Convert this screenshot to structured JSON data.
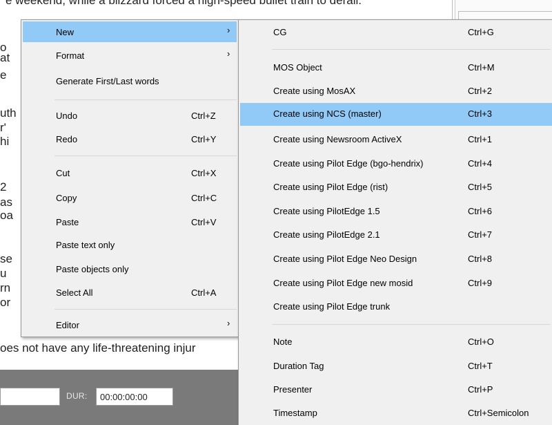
{
  "document": {
    "top_line": "e weekend, while a blizzard forced a high-speed bullet train to derail.",
    "bottom_line": "oes not have any life-threatening injur",
    "fragments": [
      "o",
      "at",
      "e",
      "uth",
      "r'",
      "hi",
      "2",
      "as",
      "oa",
      "se",
      "u",
      "rn",
      "or"
    ]
  },
  "duration_bar": {
    "label": "DUR:",
    "value": "00:00:00:00"
  },
  "context_menu": {
    "items": [
      {
        "label": "New",
        "shortcut": "",
        "has_submenu": true,
        "highlighted": true
      },
      {
        "label": "Format",
        "shortcut": "",
        "has_submenu": true
      },
      {
        "label": "Generate First/Last words",
        "shortcut": ""
      },
      {
        "label": "Undo",
        "shortcut": "Ctrl+Z"
      },
      {
        "label": "Redo",
        "shortcut": "Ctrl+Y"
      },
      {
        "label": "Cut",
        "shortcut": "Ctrl+X"
      },
      {
        "label": "Copy",
        "shortcut": "Ctrl+C"
      },
      {
        "label": "Paste",
        "shortcut": "Ctrl+V"
      },
      {
        "label": "Paste text only",
        "shortcut": ""
      },
      {
        "label": "Paste objects only",
        "shortcut": ""
      },
      {
        "label": "Select All",
        "shortcut": "Ctrl+A"
      },
      {
        "label": "Editor",
        "shortcut": "",
        "has_submenu": true
      }
    ],
    "submenu_arrow": "›"
  },
  "new_submenu": {
    "items": [
      {
        "label": "CG",
        "shortcut": "Ctrl+G"
      },
      {
        "label": "MOS Object",
        "shortcut": "Ctrl+M"
      },
      {
        "label": "Create using MosAX",
        "shortcut": "Ctrl+2"
      },
      {
        "label": "Create using NCS (master)",
        "shortcut": "Ctrl+3",
        "highlighted": true
      },
      {
        "label": "Create using Newsroom ActiveX",
        "shortcut": "Ctrl+1"
      },
      {
        "label": "Create using Pilot Edge (bgo-hendrix)",
        "shortcut": "Ctrl+4"
      },
      {
        "label": "Create using Pilot Edge (rist)",
        "shortcut": "Ctrl+5"
      },
      {
        "label": "Create using PilotEdge 1.5",
        "shortcut": "Ctrl+6"
      },
      {
        "label": "Create using PilotEdge 2.1",
        "shortcut": "Ctrl+7"
      },
      {
        "label": "Create using Pilot Edge Neo Design",
        "shortcut": "Ctrl+8"
      },
      {
        "label": "Create using Pilot Edge new mosid",
        "shortcut": "Ctrl+9"
      },
      {
        "label": "Create using Pilot Edge trunk",
        "shortcut": ""
      },
      {
        "label": "Note",
        "shortcut": "Ctrl+O"
      },
      {
        "label": "Duration Tag",
        "shortcut": "Ctrl+T"
      },
      {
        "label": "Presenter",
        "shortcut": "Ctrl+P"
      },
      {
        "label": "Timestamp",
        "shortcut": "Ctrl+Semicolon"
      }
    ]
  },
  "colors": {
    "highlight": "#91c9f7",
    "menu_background": "#f0f0f0",
    "status_bar": "#7a7a7a"
  }
}
